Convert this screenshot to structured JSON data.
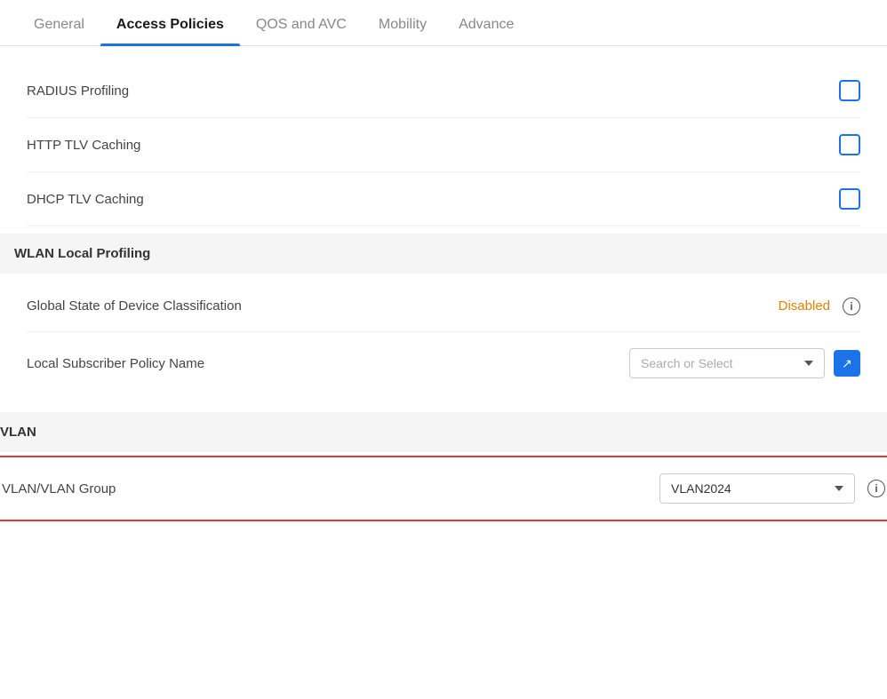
{
  "tabs": [
    {
      "id": "general",
      "label": "General",
      "active": false
    },
    {
      "id": "access-policies",
      "label": "Access Policies",
      "active": true
    },
    {
      "id": "qos-avc",
      "label": "QOS and AVC",
      "active": false
    },
    {
      "id": "mobility",
      "label": "Mobility",
      "active": false
    },
    {
      "id": "advance",
      "label": "Advance",
      "active": false
    }
  ],
  "fields": {
    "radius_profiling": {
      "label": "RADIUS Profiling",
      "checked": false
    },
    "http_tlv_caching": {
      "label": "HTTP TLV Caching",
      "checked": false
    },
    "dhcp_tlv_caching": {
      "label": "DHCP TLV Caching",
      "checked": false
    }
  },
  "sections": {
    "wlan_local_profiling": "WLAN Local Profiling",
    "vlan": "VLAN"
  },
  "global_state": {
    "label": "Global State of Device Classification",
    "status": "Disabled"
  },
  "local_subscriber": {
    "label": "Local Subscriber Policy Name",
    "placeholder": "Search or Select"
  },
  "vlan_group": {
    "label": "VLAN/VLAN Group",
    "value": "VLAN2024"
  },
  "icons": {
    "chevron": "▼",
    "external_link": "↗",
    "info": "i"
  }
}
